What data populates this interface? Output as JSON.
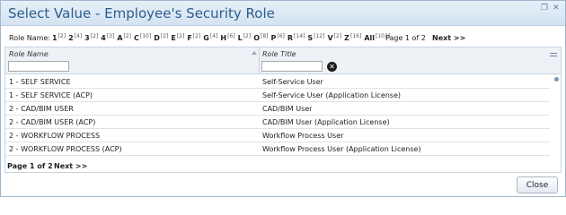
{
  "dialog": {
    "title": "Select Value - Employee's Security Role",
    "minimize_glyph": "❐",
    "close_glyph": "✕"
  },
  "filter": {
    "label": "Role Name:",
    "letters": [
      {
        "letter": "1",
        "count": "[2]"
      },
      {
        "letter": "2",
        "count": "[4]"
      },
      {
        "letter": "3",
        "count": "[2]"
      },
      {
        "letter": "4",
        "count": "[3]"
      },
      {
        "letter": "A",
        "count": "[2]"
      },
      {
        "letter": "C",
        "count": "[10]"
      },
      {
        "letter": "D",
        "count": "[2]"
      },
      {
        "letter": "E",
        "count": "[2]"
      },
      {
        "letter": "F",
        "count": "[2]"
      },
      {
        "letter": "G",
        "count": "[4]"
      },
      {
        "letter": "H",
        "count": "[6]"
      },
      {
        "letter": "L",
        "count": "[2]"
      },
      {
        "letter": "O",
        "count": "[8]"
      },
      {
        "letter": "P",
        "count": "[6]"
      },
      {
        "letter": "R",
        "count": "[14]"
      },
      {
        "letter": "S",
        "count": "[12]"
      },
      {
        "letter": "V",
        "count": "[2]"
      },
      {
        "letter": "Z",
        "count": "[16]"
      },
      {
        "letter": "All",
        "count": "[103]"
      }
    ],
    "page_info": "Page 1 of 2",
    "next_label": "Next >>"
  },
  "grid": {
    "columns": [
      {
        "header": "Role Name",
        "filter_value": "",
        "filter_placeholder": ""
      },
      {
        "header": "Role Title",
        "filter_value": "",
        "filter_placeholder": ""
      }
    ],
    "rows": [
      {
        "name": "1 - SELF SERVICE",
        "title": "Self-Service User"
      },
      {
        "name": "1 - SELF SERVICE (ACP)",
        "title": "Self-Service User (Application License)"
      },
      {
        "name": "2 - CAD/BIM USER",
        "title": "CAD/BIM User"
      },
      {
        "name": "2 - CAD/BIM USER (ACP)",
        "title": "CAD/BIM User (Application License)"
      },
      {
        "name": "2 - WORKFLOW PROCESS",
        "title": "Workflow Process User"
      },
      {
        "name": "2 - WORKFLOW PROCESS (ACP)",
        "title": "Workflow Process User (Application License)"
      }
    ],
    "clear_glyph": "✕",
    "footer": {
      "page_info": "Page 1 of 2",
      "next_label": "Next >>"
    }
  },
  "buttons": {
    "close_label": "Close"
  }
}
